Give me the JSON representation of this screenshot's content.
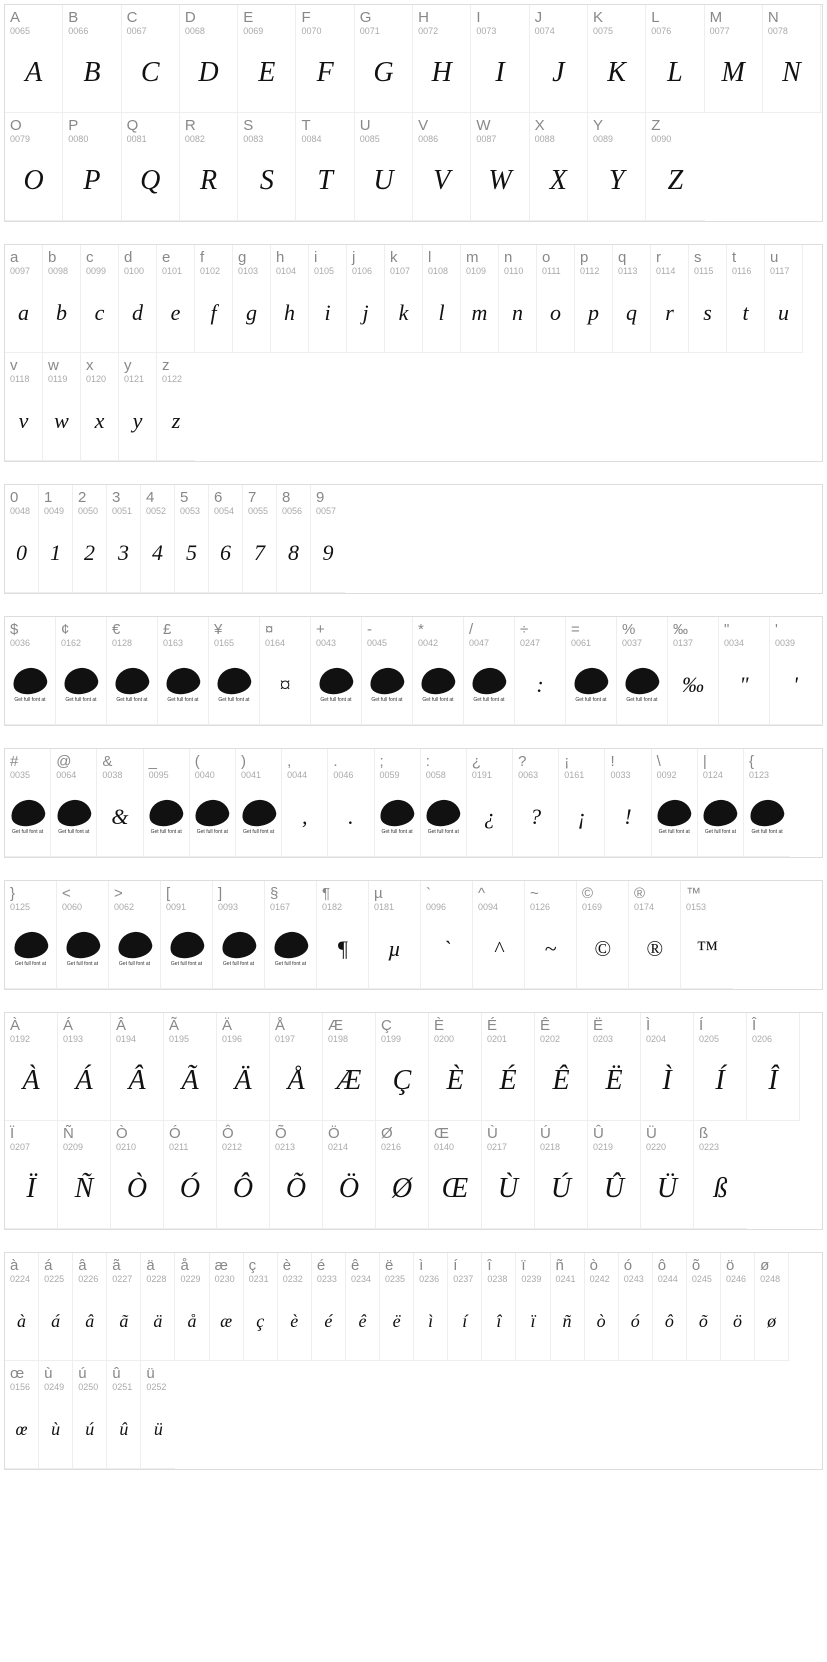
{
  "sections": [
    {
      "id": "uppercase",
      "cellClass": "w-upper",
      "glyphClass": "",
      "cells": [
        {
          "char": "A",
          "code": "0065",
          "glyph": "A"
        },
        {
          "char": "B",
          "code": "0066",
          "glyph": "B"
        },
        {
          "char": "C",
          "code": "0067",
          "glyph": "C"
        },
        {
          "char": "D",
          "code": "0068",
          "glyph": "D"
        },
        {
          "char": "E",
          "code": "0069",
          "glyph": "E"
        },
        {
          "char": "F",
          "code": "0070",
          "glyph": "F"
        },
        {
          "char": "G",
          "code": "0071",
          "glyph": "G"
        },
        {
          "char": "H",
          "code": "0072",
          "glyph": "H"
        },
        {
          "char": "I",
          "code": "0073",
          "glyph": "I"
        },
        {
          "char": "J",
          "code": "0074",
          "glyph": "J"
        },
        {
          "char": "K",
          "code": "0075",
          "glyph": "K"
        },
        {
          "char": "L",
          "code": "0076",
          "glyph": "L"
        },
        {
          "char": "M",
          "code": "0077",
          "glyph": "M"
        },
        {
          "char": "N",
          "code": "0078",
          "glyph": "N"
        },
        {
          "char": "O",
          "code": "0079",
          "glyph": "O"
        },
        {
          "char": "P",
          "code": "0080",
          "glyph": "P"
        },
        {
          "char": "Q",
          "code": "0081",
          "glyph": "Q"
        },
        {
          "char": "R",
          "code": "0082",
          "glyph": "R"
        },
        {
          "char": "S",
          "code": "0083",
          "glyph": "S"
        },
        {
          "char": "T",
          "code": "0084",
          "glyph": "T"
        },
        {
          "char": "U",
          "code": "0085",
          "glyph": "U"
        },
        {
          "char": "V",
          "code": "0086",
          "glyph": "V"
        },
        {
          "char": "W",
          "code": "0087",
          "glyph": "W"
        },
        {
          "char": "X",
          "code": "0088",
          "glyph": "X"
        },
        {
          "char": "Y",
          "code": "0089",
          "glyph": "Y"
        },
        {
          "char": "Z",
          "code": "0090",
          "glyph": "Z"
        }
      ]
    },
    {
      "id": "lowercase",
      "cellClass": "w-lower",
      "glyphClass": "small",
      "cells": [
        {
          "char": "a",
          "code": "0097",
          "glyph": "a"
        },
        {
          "char": "b",
          "code": "0098",
          "glyph": "b"
        },
        {
          "char": "c",
          "code": "0099",
          "glyph": "c"
        },
        {
          "char": "d",
          "code": "0100",
          "glyph": "d"
        },
        {
          "char": "e",
          "code": "0101",
          "glyph": "e"
        },
        {
          "char": "f",
          "code": "0102",
          "glyph": "f"
        },
        {
          "char": "g",
          "code": "0103",
          "glyph": "g"
        },
        {
          "char": "h",
          "code": "0104",
          "glyph": "h"
        },
        {
          "char": "i",
          "code": "0105",
          "glyph": "i"
        },
        {
          "char": "j",
          "code": "0106",
          "glyph": "j"
        },
        {
          "char": "k",
          "code": "0107",
          "glyph": "k"
        },
        {
          "char": "l",
          "code": "0108",
          "glyph": "l"
        },
        {
          "char": "m",
          "code": "0109",
          "glyph": "m"
        },
        {
          "char": "n",
          "code": "0110",
          "glyph": "n"
        },
        {
          "char": "o",
          "code": "0111",
          "glyph": "o"
        },
        {
          "char": "p",
          "code": "0112",
          "glyph": "p"
        },
        {
          "char": "q",
          "code": "0113",
          "glyph": "q"
        },
        {
          "char": "r",
          "code": "0114",
          "glyph": "r"
        },
        {
          "char": "s",
          "code": "0115",
          "glyph": "s"
        },
        {
          "char": "t",
          "code": "0116",
          "glyph": "t"
        },
        {
          "char": "u",
          "code": "0117",
          "glyph": "u"
        },
        {
          "char": "v",
          "code": "0118",
          "glyph": "v"
        },
        {
          "char": "w",
          "code": "0119",
          "glyph": "w"
        },
        {
          "char": "x",
          "code": "0120",
          "glyph": "x"
        },
        {
          "char": "y",
          "code": "0121",
          "glyph": "y"
        },
        {
          "char": "z",
          "code": "0122",
          "glyph": "z"
        }
      ]
    },
    {
      "id": "digits",
      "cellClass": "w-digit",
      "glyphClass": "small",
      "cells": [
        {
          "char": "0",
          "code": "0048",
          "glyph": "0"
        },
        {
          "char": "1",
          "code": "0049",
          "glyph": "1"
        },
        {
          "char": "2",
          "code": "0050",
          "glyph": "2"
        },
        {
          "char": "3",
          "code": "0051",
          "glyph": "3"
        },
        {
          "char": "4",
          "code": "0052",
          "glyph": "4"
        },
        {
          "char": "5",
          "code": "0053",
          "glyph": "5"
        },
        {
          "char": "6",
          "code": "0054",
          "glyph": "6"
        },
        {
          "char": "7",
          "code": "0055",
          "glyph": "7"
        },
        {
          "char": "8",
          "code": "0056",
          "glyph": "8"
        },
        {
          "char": "9",
          "code": "0057",
          "glyph": "9"
        }
      ]
    },
    {
      "id": "symbols1",
      "cellClass": "w-sym1",
      "glyphClass": "small",
      "cells": [
        {
          "char": "$",
          "code": "0036",
          "glyph": "",
          "logo": true
        },
        {
          "char": "¢",
          "code": "0162",
          "glyph": "",
          "logo": true
        },
        {
          "char": "€",
          "code": "0128",
          "glyph": "",
          "logo": true
        },
        {
          "char": "£",
          "code": "0163",
          "glyph": "",
          "logo": true
        },
        {
          "char": "¥",
          "code": "0165",
          "glyph": "",
          "logo": true
        },
        {
          "char": "¤",
          "code": "0164",
          "glyph": "¤"
        },
        {
          "char": "+",
          "code": "0043",
          "glyph": "",
          "logo": true
        },
        {
          "char": "-",
          "code": "0045",
          "glyph": "",
          "logo": true
        },
        {
          "char": "*",
          "code": "0042",
          "glyph": "",
          "logo": true
        },
        {
          "char": "/",
          "code": "0047",
          "glyph": "",
          "logo": true
        },
        {
          "char": "÷",
          "code": "0247",
          "glyph": ":"
        },
        {
          "char": "=",
          "code": "0061",
          "glyph": "",
          "logo": true
        },
        {
          "char": "%",
          "code": "0037",
          "glyph": "",
          "logo": true
        },
        {
          "char": "‰",
          "code": "0137",
          "glyph": "‰"
        },
        {
          "char": "\"",
          "code": "0034",
          "glyph": "\""
        },
        {
          "char": "'",
          "code": "0039",
          "glyph": "'"
        }
      ]
    },
    {
      "id": "symbols2",
      "cellClass": "w-sym2",
      "glyphClass": "small",
      "cells": [
        {
          "char": "#",
          "code": "0035",
          "glyph": "",
          "logo": true
        },
        {
          "char": "@",
          "code": "0064",
          "glyph": "",
          "logo": true
        },
        {
          "char": "&",
          "code": "0038",
          "glyph": "&"
        },
        {
          "char": "_",
          "code": "0095",
          "glyph": "",
          "logo": true
        },
        {
          "char": "(",
          "code": "0040",
          "glyph": "",
          "logo": true
        },
        {
          "char": ")",
          "code": "0041",
          "glyph": "",
          "logo": true
        },
        {
          "char": ",",
          "code": "0044",
          "glyph": ","
        },
        {
          "char": ".",
          "code": "0046",
          "glyph": "."
        },
        {
          "char": ";",
          "code": "0059",
          "glyph": "",
          "logo": true
        },
        {
          "char": ":",
          "code": "0058",
          "glyph": "",
          "logo": true
        },
        {
          "char": "¿",
          "code": "0191",
          "glyph": "¿"
        },
        {
          "char": "?",
          "code": "0063",
          "glyph": "?"
        },
        {
          "char": "¡",
          "code": "0161",
          "glyph": "¡"
        },
        {
          "char": "!",
          "code": "0033",
          "glyph": "!"
        },
        {
          "char": "\\",
          "code": "0092",
          "glyph": "",
          "logo": true
        },
        {
          "char": "|",
          "code": "0124",
          "glyph": "",
          "logo": true
        },
        {
          "char": "{",
          "code": "0123",
          "glyph": "",
          "logo": true
        }
      ]
    },
    {
      "id": "symbols3",
      "cellClass": "w-sym3",
      "glyphClass": "small",
      "cells": [
        {
          "char": "}",
          "code": "0125",
          "glyph": "",
          "logo": true
        },
        {
          "char": "<",
          "code": "0060",
          "glyph": "",
          "logo": true
        },
        {
          "char": ">",
          "code": "0062",
          "glyph": "",
          "logo": true
        },
        {
          "char": "[",
          "code": "0091",
          "glyph": "",
          "logo": true
        },
        {
          "char": "]",
          "code": "0093",
          "glyph": "",
          "logo": true
        },
        {
          "char": "§",
          "code": "0167",
          "glyph": "",
          "logo": true
        },
        {
          "char": "¶",
          "code": "0182",
          "glyph": "¶"
        },
        {
          "char": "µ",
          "code": "0181",
          "glyph": "µ"
        },
        {
          "char": "`",
          "code": "0096",
          "glyph": "`"
        },
        {
          "char": "^",
          "code": "0094",
          "glyph": "^"
        },
        {
          "char": "~",
          "code": "0126",
          "glyph": "~"
        },
        {
          "char": "©",
          "code": "0169",
          "glyph": "©"
        },
        {
          "char": "®",
          "code": "0174",
          "glyph": "®"
        },
        {
          "char": "™",
          "code": "0153",
          "glyph": "™"
        }
      ]
    },
    {
      "id": "accented-upper",
      "cellClass": "w-accent-u",
      "glyphClass": "",
      "cells": [
        {
          "char": "À",
          "code": "0192",
          "glyph": "À"
        },
        {
          "char": "Á",
          "code": "0193",
          "glyph": "Á"
        },
        {
          "char": "Â",
          "code": "0194",
          "glyph": "Â"
        },
        {
          "char": "Ã",
          "code": "0195",
          "glyph": "Ã"
        },
        {
          "char": "Ä",
          "code": "0196",
          "glyph": "Ä"
        },
        {
          "char": "Å",
          "code": "0197",
          "glyph": "Å"
        },
        {
          "char": "Æ",
          "code": "0198",
          "glyph": "Æ"
        },
        {
          "char": "Ç",
          "code": "0199",
          "glyph": "Ç"
        },
        {
          "char": "È",
          "code": "0200",
          "glyph": "È"
        },
        {
          "char": "É",
          "code": "0201",
          "glyph": "É"
        },
        {
          "char": "Ê",
          "code": "0202",
          "glyph": "Ê"
        },
        {
          "char": "Ë",
          "code": "0203",
          "glyph": "Ë"
        },
        {
          "char": "Ì",
          "code": "0204",
          "glyph": "Ì"
        },
        {
          "char": "Í",
          "code": "0205",
          "glyph": "Í"
        },
        {
          "char": "Î",
          "code": "0206",
          "glyph": "Î"
        },
        {
          "char": "Ï",
          "code": "0207",
          "glyph": "Ï"
        },
        {
          "char": "Ñ",
          "code": "0209",
          "glyph": "Ñ"
        },
        {
          "char": "Ò",
          "code": "0210",
          "glyph": "Ò"
        },
        {
          "char": "Ó",
          "code": "0211",
          "glyph": "Ó"
        },
        {
          "char": "Ô",
          "code": "0212",
          "glyph": "Ô"
        },
        {
          "char": "Õ",
          "code": "0213",
          "glyph": "Õ"
        },
        {
          "char": "Ö",
          "code": "0214",
          "glyph": "Ö"
        },
        {
          "char": "Ø",
          "code": "0216",
          "glyph": "Ø"
        },
        {
          "char": "Œ",
          "code": "0140",
          "glyph": "Œ"
        },
        {
          "char": "Ù",
          "code": "0217",
          "glyph": "Ù"
        },
        {
          "char": "Ú",
          "code": "0218",
          "glyph": "Ú"
        },
        {
          "char": "Û",
          "code": "0219",
          "glyph": "Û"
        },
        {
          "char": "Ü",
          "code": "0220",
          "glyph": "Ü"
        },
        {
          "char": "ß",
          "code": "0223",
          "glyph": "ß"
        }
      ]
    },
    {
      "id": "accented-lower",
      "cellClass": "w-accent-l",
      "glyphClass": "tiny",
      "cells": [
        {
          "char": "à",
          "code": "0224",
          "glyph": "à"
        },
        {
          "char": "á",
          "code": "0225",
          "glyph": "á"
        },
        {
          "char": "â",
          "code": "0226",
          "glyph": "â"
        },
        {
          "char": "ã",
          "code": "0227",
          "glyph": "ã"
        },
        {
          "char": "ä",
          "code": "0228",
          "glyph": "ä"
        },
        {
          "char": "å",
          "code": "0229",
          "glyph": "å"
        },
        {
          "char": "æ",
          "code": "0230",
          "glyph": "æ"
        },
        {
          "char": "ç",
          "code": "0231",
          "glyph": "ç"
        },
        {
          "char": "è",
          "code": "0232",
          "glyph": "è"
        },
        {
          "char": "é",
          "code": "0233",
          "glyph": "é"
        },
        {
          "char": "ê",
          "code": "0234",
          "glyph": "ê"
        },
        {
          "char": "ë",
          "code": "0235",
          "glyph": "ë"
        },
        {
          "char": "ì",
          "code": "0236",
          "glyph": "ì"
        },
        {
          "char": "í",
          "code": "0237",
          "glyph": "í"
        },
        {
          "char": "î",
          "code": "0238",
          "glyph": "î"
        },
        {
          "char": "ï",
          "code": "0239",
          "glyph": "ï"
        },
        {
          "char": "ñ",
          "code": "0241",
          "glyph": "ñ"
        },
        {
          "char": "ò",
          "code": "0242",
          "glyph": "ò"
        },
        {
          "char": "ó",
          "code": "0243",
          "glyph": "ó"
        },
        {
          "char": "ô",
          "code": "0244",
          "glyph": "ô"
        },
        {
          "char": "õ",
          "code": "0245",
          "glyph": "õ"
        },
        {
          "char": "ö",
          "code": "0246",
          "glyph": "ö"
        },
        {
          "char": "ø",
          "code": "0248",
          "glyph": "ø"
        },
        {
          "char": "œ",
          "code": "0156",
          "glyph": "œ"
        },
        {
          "char": "ù",
          "code": "0249",
          "glyph": "ù"
        },
        {
          "char": "ú",
          "code": "0250",
          "glyph": "ú"
        },
        {
          "char": "û",
          "code": "0251",
          "glyph": "û"
        },
        {
          "char": "ü",
          "code": "0252",
          "glyph": "ü"
        }
      ]
    }
  ],
  "logo_caption": "Get full font at"
}
